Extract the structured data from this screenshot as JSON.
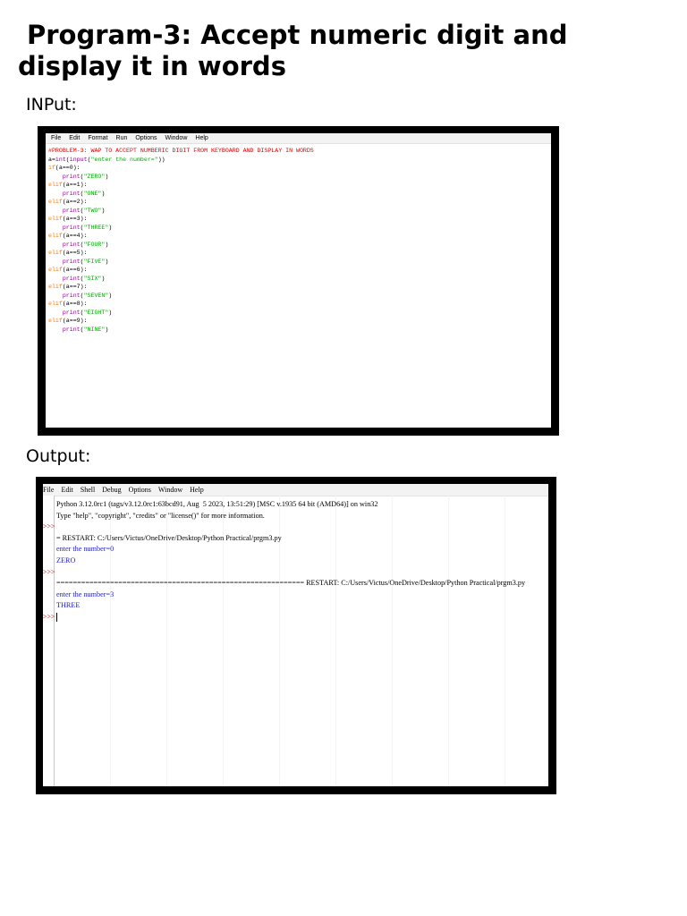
{
  "title": {
    "line1": "Program-3: Accept numeric digit and",
    "line2": "display it in words"
  },
  "input_label": "INPut:",
  "output_label": "Output:",
  "editor": {
    "menu": [
      "File",
      "Edit",
      "Format",
      "Run",
      "Options",
      "Window",
      "Help"
    ],
    "code": [
      [
        {
          "t": "#PROBLEM-3: WAP TO ACCEPT NUMBERIC DIGIT FROM KEYBOARD AND DISPLAY IN WORDS",
          "c": "comment"
        }
      ],
      [
        {
          "t": "a=",
          "c": "plain"
        },
        {
          "t": "int",
          "c": "builtin"
        },
        {
          "t": "(",
          "c": "plain"
        },
        {
          "t": "input",
          "c": "builtin"
        },
        {
          "t": "(",
          "c": "plain"
        },
        {
          "t": "\"enter the number=\"",
          "c": "str"
        },
        {
          "t": "))",
          "c": "plain"
        }
      ],
      [
        {
          "t": "if",
          "c": "kw"
        },
        {
          "t": "(a==0):",
          "c": "plain"
        }
      ],
      [
        {
          "t": "    ",
          "c": "plain"
        },
        {
          "t": "print",
          "c": "builtin"
        },
        {
          "t": "(",
          "c": "plain"
        },
        {
          "t": "\"ZERO\"",
          "c": "str"
        },
        {
          "t": ")",
          "c": "plain"
        }
      ],
      [
        {
          "t": "elif",
          "c": "kw"
        },
        {
          "t": "(a==1):",
          "c": "plain"
        }
      ],
      [
        {
          "t": "    ",
          "c": "plain"
        },
        {
          "t": "print",
          "c": "builtin"
        },
        {
          "t": "(",
          "c": "plain"
        },
        {
          "t": "\"ONE\"",
          "c": "str"
        },
        {
          "t": ")",
          "c": "plain"
        }
      ],
      [
        {
          "t": "elif",
          "c": "kw"
        },
        {
          "t": "(a==2):",
          "c": "plain"
        }
      ],
      [
        {
          "t": "    ",
          "c": "plain"
        },
        {
          "t": "print",
          "c": "builtin"
        },
        {
          "t": "(",
          "c": "plain"
        },
        {
          "t": "\"TWO\"",
          "c": "str"
        },
        {
          "t": ")",
          "c": "plain"
        }
      ],
      [
        {
          "t": "elif",
          "c": "kw"
        },
        {
          "t": "(a==3):",
          "c": "plain"
        }
      ],
      [
        {
          "t": "    ",
          "c": "plain"
        },
        {
          "t": "print",
          "c": "builtin"
        },
        {
          "t": "(",
          "c": "plain"
        },
        {
          "t": "\"THREE\"",
          "c": "str"
        },
        {
          "t": ")",
          "c": "plain"
        }
      ],
      [
        {
          "t": "elif",
          "c": "kw"
        },
        {
          "t": "(a==4):",
          "c": "plain"
        }
      ],
      [
        {
          "t": "    ",
          "c": "plain"
        },
        {
          "t": "print",
          "c": "builtin"
        },
        {
          "t": "(",
          "c": "plain"
        },
        {
          "t": "\"FOUR\"",
          "c": "str"
        },
        {
          "t": ")",
          "c": "plain"
        }
      ],
      [
        {
          "t": "elif",
          "c": "kw"
        },
        {
          "t": "(a==5):",
          "c": "plain"
        }
      ],
      [
        {
          "t": "    ",
          "c": "plain"
        },
        {
          "t": "print",
          "c": "builtin"
        },
        {
          "t": "(",
          "c": "plain"
        },
        {
          "t": "\"FIVE\"",
          "c": "str"
        },
        {
          "t": ")",
          "c": "plain"
        }
      ],
      [
        {
          "t": "elif",
          "c": "kw"
        },
        {
          "t": "(a==6):",
          "c": "plain"
        }
      ],
      [
        {
          "t": "    ",
          "c": "plain"
        },
        {
          "t": "print",
          "c": "builtin"
        },
        {
          "t": "(",
          "c": "plain"
        },
        {
          "t": "\"SIX\"",
          "c": "str"
        },
        {
          "t": ")",
          "c": "plain"
        }
      ],
      [
        {
          "t": "elif",
          "c": "kw"
        },
        {
          "t": "(a==7):",
          "c": "plain"
        }
      ],
      [
        {
          "t": "    ",
          "c": "plain"
        },
        {
          "t": "print",
          "c": "builtin"
        },
        {
          "t": "(",
          "c": "plain"
        },
        {
          "t": "\"SEVEN\"",
          "c": "str"
        },
        {
          "t": ")",
          "c": "plain"
        }
      ],
      [
        {
          "t": "elif",
          "c": "kw"
        },
        {
          "t": "(a==8):",
          "c": "plain"
        }
      ],
      [
        {
          "t": "    ",
          "c": "plain"
        },
        {
          "t": "print",
          "c": "builtin"
        },
        {
          "t": "(",
          "c": "plain"
        },
        {
          "t": "\"EIGHT\"",
          "c": "str"
        },
        {
          "t": ")",
          "c": "plain"
        }
      ],
      [
        {
          "t": "elif",
          "c": "kw"
        },
        {
          "t": "(a==9):",
          "c": "plain"
        }
      ],
      [
        {
          "t": "    ",
          "c": "plain"
        },
        {
          "t": "print",
          "c": "builtin"
        },
        {
          "t": "(",
          "c": "plain"
        },
        {
          "t": "\"NINE\"",
          "c": "str"
        },
        {
          "t": ")",
          "c": "plain"
        }
      ]
    ]
  },
  "shell": {
    "menu": [
      "File",
      "Edit",
      "Shell",
      "Debug",
      "Options",
      "Window",
      "Help"
    ],
    "prompt": ">>>",
    "lines": [
      {
        "t": "Python 3.12.0rc1 (tags/v3.12.0rc1:63bcd91, Aug  5 2023, 13:51:29) [MSC v.1935 64 bit (AMD64)] on win32",
        "c": "plain",
        "prompt": false
      },
      {
        "t": "Type \"help\", \"copyright\", \"credits\" or \"license()\" for more information.",
        "c": "plain",
        "prompt": false
      },
      {
        "t": "",
        "c": "plain",
        "prompt": true
      },
      {
        "t": "= RESTART: C:/Users/Victus/OneDrive/Desktop/Python Practical/prgm3.py",
        "c": "plain",
        "prompt": false
      },
      {
        "t": "enter the number=0",
        "c": "out",
        "prompt": false
      },
      {
        "t": "ZERO",
        "c": "out",
        "prompt": false
      },
      {
        "t": "",
        "c": "plain",
        "prompt": true
      },
      {
        "t": "============================================================ RESTART: C:/Users/Victus/OneDrive/Desktop/Python Practical/prgm3.py",
        "c": "plain",
        "prompt": false
      },
      {
        "t": "enter the number=3",
        "c": "out",
        "prompt": false
      },
      {
        "t": "THREE",
        "c": "out",
        "prompt": false
      },
      {
        "t": "",
        "c": "plain",
        "prompt": true,
        "cursor": true
      }
    ]
  }
}
